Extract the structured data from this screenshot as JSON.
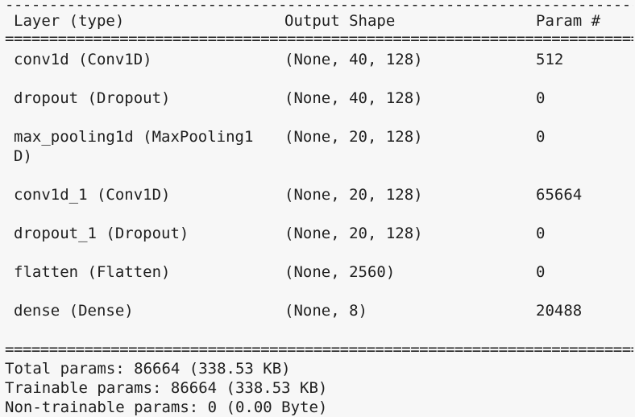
{
  "summary": {
    "rule_dash": "-----------------------------------------------------------------------------------",
    "rule_eq": "=================================================================================",
    "headers": {
      "layer": "Layer (type)",
      "output": "Output Shape",
      "params": "Param #"
    },
    "layers": [
      {
        "name": "conv1d (Conv1D)",
        "output": "(None, 40, 128)",
        "params": "512"
      },
      {
        "name": "dropout (Dropout)",
        "output": "(None, 40, 128)",
        "params": "0"
      },
      {
        "name": "max_pooling1d (MaxPooling1",
        "name_cont": "D)",
        "output": "(None, 20, 128)",
        "params": "0"
      },
      {
        "name": "conv1d_1 (Conv1D)",
        "output": "(None, 20, 128)",
        "params": "65664"
      },
      {
        "name": "dropout_1 (Dropout)",
        "output": "(None, 20, 128)",
        "params": "0"
      },
      {
        "name": "flatten (Flatten)",
        "output": "(None, 2560)",
        "params": "0"
      },
      {
        "name": "dense (Dense)",
        "output": "(None, 8)",
        "params": "20488"
      }
    ],
    "totals": {
      "total": "Total params: 86664 (338.53 KB)",
      "trainable": "Trainable params: 86664 (338.53 KB)",
      "non_trainable": "Non-trainable params: 0 (0.00 Byte)"
    }
  }
}
